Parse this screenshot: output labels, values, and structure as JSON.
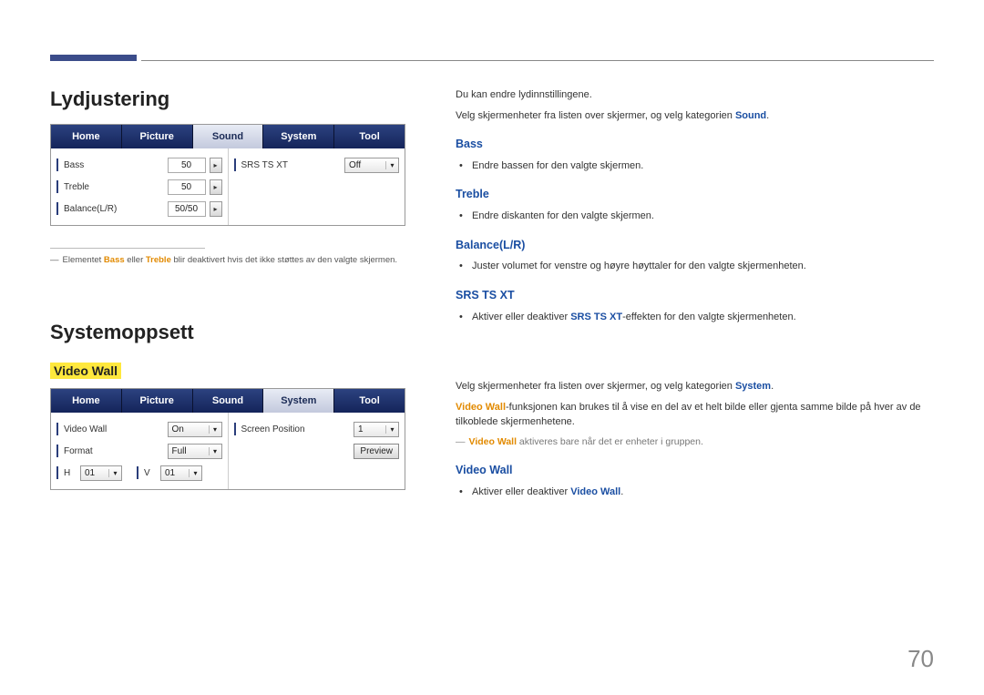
{
  "page_number": "70",
  "section1": {
    "title": "Lydjustering",
    "tabs": [
      "Home",
      "Picture",
      "Sound",
      "System",
      "Tool"
    ],
    "active_tab_index": 2,
    "left_controls": [
      {
        "label": "Bass",
        "value": "50"
      },
      {
        "label": "Treble",
        "value": "50"
      },
      {
        "label": "Balance(L/R)",
        "value": "50/50"
      }
    ],
    "right_controls": [
      {
        "label": "SRS TS XT",
        "value": "Off"
      }
    ],
    "footnote_prefix": "Elementet ",
    "footnote_b1": "Bass",
    "footnote_mid": " eller ",
    "footnote_b2": "Treble",
    "footnote_suffix": " blir deaktivert hvis det ikke støttes av den valgte skjermen."
  },
  "right1": {
    "intro1": "Du kan endre lydinnstillingene.",
    "intro2_a": "Velg skjermenheter fra listen over skjermer, og velg kategorien ",
    "intro2_b": "Sound",
    "intro2_c": ".",
    "items": [
      {
        "h": "Bass",
        "t": "Endre bassen for den valgte skjermen."
      },
      {
        "h": "Treble",
        "t": "Endre diskanten for den valgte skjermen."
      },
      {
        "h": "Balance(L/R)",
        "t": "Juster volumet for venstre og høyre høyttaler for den valgte skjermenheten."
      }
    ],
    "srs": {
      "h": "SRS TS XT",
      "t_a": "Aktiver eller deaktiver ",
      "t_b": "SRS TS XT",
      "t_c": "-effekten for den valgte skjermenheten."
    }
  },
  "section2": {
    "title": "Systemoppsett",
    "sub_highlight": "Video Wall",
    "tabs": [
      "Home",
      "Picture",
      "Sound",
      "System",
      "Tool"
    ],
    "active_tab_index": 3,
    "left_controls": {
      "videowall_label": "Video Wall",
      "videowall_value": "On",
      "format_label": "Format",
      "format_value": "Full",
      "h_label": "H",
      "h_value": "01",
      "v_label": "V",
      "v_value": "01"
    },
    "right_controls": {
      "screenpos_label": "Screen Position",
      "screenpos_value": "1",
      "preview_label": "Preview"
    }
  },
  "right2": {
    "intro_a": "Velg skjermenheter fra listen over skjermer, og velg kategorien ",
    "intro_b": "System",
    "intro_c": ".",
    "desc_a": "Video Wall",
    "desc_b": "-funksjonen kan brukes til å vise en del av et helt bilde eller gjenta samme bilde på hver av de tilkoblede skjermenhetene.",
    "note_a": "Video Wall",
    "note_b": " aktiveres bare når det er enheter i gruppen.",
    "vw_h": "Video Wall",
    "vw_t_a": "Aktiver eller deaktiver ",
    "vw_t_b": "Video Wall",
    "vw_t_c": "."
  }
}
